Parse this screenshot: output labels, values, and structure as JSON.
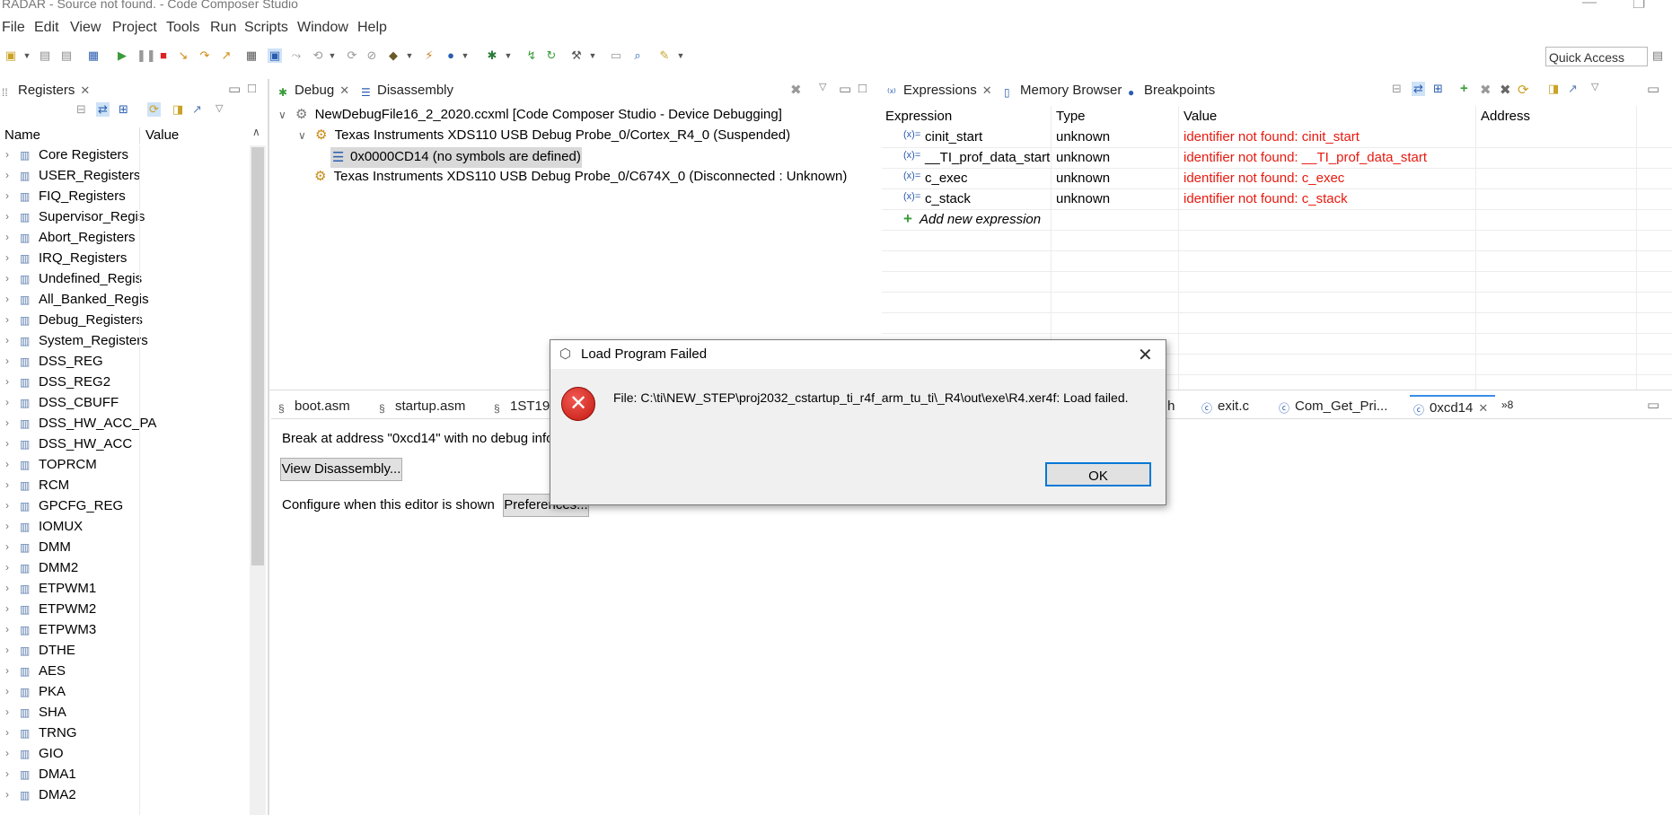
{
  "window": {
    "title": "RADAR - Source not found. - Code Composer Studio"
  },
  "menu": [
    "File",
    "Edit",
    "View",
    "Project",
    "Tools",
    "Run",
    "Scripts",
    "Window",
    "Help"
  ],
  "quick_access": "Quick Access",
  "registers": {
    "tab": "Registers",
    "col_name": "Name",
    "col_value": "Value",
    "items": [
      "Core Registers",
      "USER_Registers",
      "FIQ_Registers",
      "Supervisor_Regis",
      "Abort_Registers",
      "IRQ_Registers",
      "Undefined_Regis",
      "All_Banked_Regis",
      "Debug_Registers",
      "System_Registers",
      "DSS_REG",
      "DSS_REG2",
      "DSS_CBUFF",
      "DSS_HW_ACC_PA",
      "DSS_HW_ACC",
      "TOPRCM",
      "RCM",
      "GPCFG_REG",
      "IOMUX",
      "DMM",
      "DMM2",
      "ETPWM1",
      "ETPWM2",
      "ETPWM3",
      "DTHE",
      "AES",
      "PKA",
      "SHA",
      "TRNG",
      "GIO",
      "DMA1",
      "DMA2"
    ]
  },
  "debug": {
    "tab_debug": "Debug",
    "tab_disassembly": "Disassembly",
    "tree": {
      "root": "NewDebugFile16_2_2020.ccxml [Code Composer Studio - Device Debugging]",
      "core1": "Texas Instruments XDS110 USB Debug Probe_0/Cortex_R4_0 (Suspended)",
      "frame": "0x0000CD14  (no symbols are defined)",
      "core2": "Texas Instruments XDS110 USB Debug Probe_0/C674X_0 (Disconnected : Unknown)"
    }
  },
  "expressions": {
    "tab_expressions": "Expressions",
    "tab_memory": "Memory Browser",
    "tab_breakpoints": "Breakpoints",
    "headers": [
      "Expression",
      "Type",
      "Value",
      "Address"
    ],
    "rows": [
      {
        "expr": "cinit_start",
        "type": "unknown",
        "value": "identifier not found: cinit_start"
      },
      {
        "expr": "__TI_prof_data_start",
        "type": "unknown",
        "value": "identifier not found: __TI_prof_data_start"
      },
      {
        "expr": "c_exec",
        "type": "unknown",
        "value": "identifier not found: c_exec"
      },
      {
        "expr": "c_stack",
        "type": "unknown",
        "value": "identifier not found: c_stack"
      }
    ],
    "add_new": "Add new expression"
  },
  "editor": {
    "tabs": [
      "boot.asm",
      "startup.asm",
      "1ST190",
      ".h",
      "exit.c",
      "Com_Get_Pri...",
      "0xcd14"
    ],
    "overflow": "»8",
    "break_msg": "Break at address \"0xcd14\" with no debug info",
    "view_disassembly": "View Disassembly...",
    "configure": "Configure when this editor is shown",
    "preferences": "Preferences..."
  },
  "dialog": {
    "title": "Load Program Failed",
    "message": "File: C:\\ti\\NEW_STEP\\proj2032_cstartup_ti_r4f_arm_tu_ti\\_R4\\out\\exe\\R4.xer4f: Load failed.",
    "ok": "OK"
  }
}
